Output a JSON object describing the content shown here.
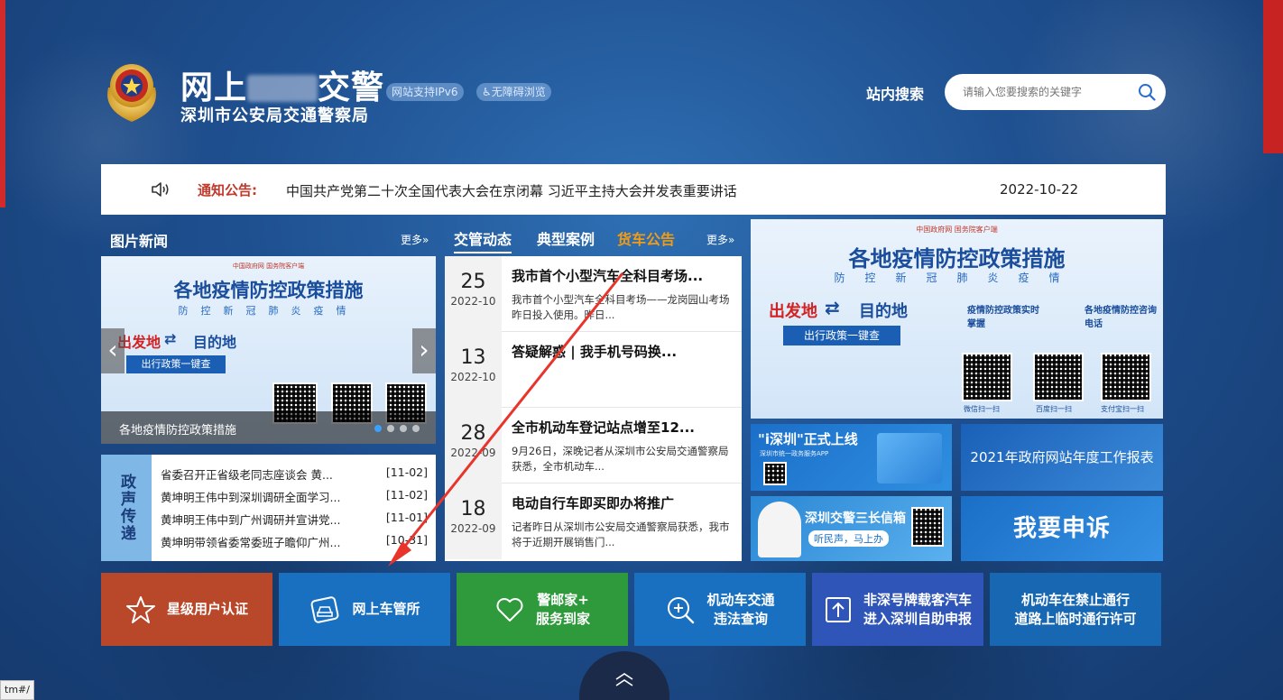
{
  "header": {
    "title_prefix": "网上",
    "title_suffix": "交警",
    "subtitle": "深圳市公安局交通警察局",
    "pill_ipv6": "网站支持IPv6",
    "pill_accessibility": "无障碍浏览",
    "search_label": "站内搜索",
    "search_placeholder": "请输入您要搜索的关键字"
  },
  "notice": {
    "label": "通知公告:",
    "text": "中国共产党第二十次全国代表大会在京闭幕 习近平主持大会并发表重要讲话",
    "date": "2022-10-22"
  },
  "photo_news": {
    "title": "图片新闻",
    "more": "更多»",
    "slide": {
      "banner_title": "各地疫情防控政策措施",
      "banner_sub": "防控新冠肺炎疫情",
      "from": "出发地",
      "to": "目的地",
      "query_btn": "出行政策一键查",
      "gov_logos": "中国政府网  国务院客户端",
      "caption": "各地疫情防控政策措施"
    }
  },
  "zheng_sheng": {
    "label": "政声传递",
    "items": [
      {
        "title": "省委召开正省级老同志座谈会 黄...",
        "date": "[11-02]"
      },
      {
        "title": "黄坤明王伟中到深圳调研全面学习...",
        "date": "[11-02]"
      },
      {
        "title": "黄坤明王伟中到广州调研并宣讲党...",
        "date": "[11-01]"
      },
      {
        "title": "黄坤明带领省委常委班子瞻仰广州...",
        "date": "[10-31]"
      }
    ]
  },
  "middle": {
    "tabs": [
      "交管动态",
      "典型案例",
      "货车公告"
    ],
    "more": "更多»",
    "news": [
      {
        "day": "25",
        "ym": "2022-10",
        "title": "我市首个小型汽车全科目考场...",
        "desc": "我市首个小型汽车全科目考场——龙岗园山考场昨日投入使用。昨日..."
      },
      {
        "day": "13",
        "ym": "2022-10",
        "title": "答疑解惑 | 我手机号码换...",
        "desc": ""
      },
      {
        "day": "28",
        "ym": "2022-09",
        "title": "全市机动车登记站点增至12...",
        "desc": "9月26日，深晚记者从深圳市公安局交通警察局获悉，全市机动车..."
      },
      {
        "day": "18",
        "ym": "2022-09",
        "title": "电动自行车即买即办将推广",
        "desc": "记者昨日从深圳市公安局交通警察局获悉，我市将于近期开展销售门..."
      }
    ]
  },
  "right": {
    "big_banner": {
      "gov_logos": "中国政府网  国务院客户端",
      "title": "各地疫情防控政策措施",
      "sub": "防控新冠肺炎疫情",
      "from": "出发地",
      "to": "目的地",
      "query_btn": "出行政策一键查",
      "item1": "疫情防控政策实时掌握",
      "item2": "各地疫情防控咨询电话",
      "qr1": "微信扫一扫",
      "qr2": "百度扫一扫",
      "qr3": "支付宝扫一扫"
    },
    "tile_ishenzhen": "\"i深圳\"正式上线",
    "tile_ishenzhen_sub": "深圳市统一政务服务APP",
    "tile_report": "2021年政府网站年度工作报表",
    "tile_letterbox": "深圳交警三长信箱",
    "tile_letterbox_sub": "听民声，马上办",
    "tile_appeal": "我要申诉"
  },
  "services": [
    {
      "label1": "星级用户认证",
      "label2": ""
    },
    {
      "label1": "网上车管所",
      "label2": ""
    },
    {
      "label1": "警邮家+",
      "label2": "服务到家"
    },
    {
      "label1": "机动车交通",
      "label2": "违法查询"
    },
    {
      "label1": "非深号牌载客汽车",
      "label2": "进入深圳自助申报"
    },
    {
      "label1": "机动车在禁止通行",
      "label2": "道路上临时通行许可"
    }
  ],
  "status_url": "tm#/",
  "colors": {
    "notice_label": "#c0392b",
    "tab_orange": "#f39c12",
    "svc_star": "#b9472a",
    "svc_blue": "#1a70c0",
    "svc_green": "#2f9a3c",
    "annotation_arrow": "#e8342a"
  }
}
